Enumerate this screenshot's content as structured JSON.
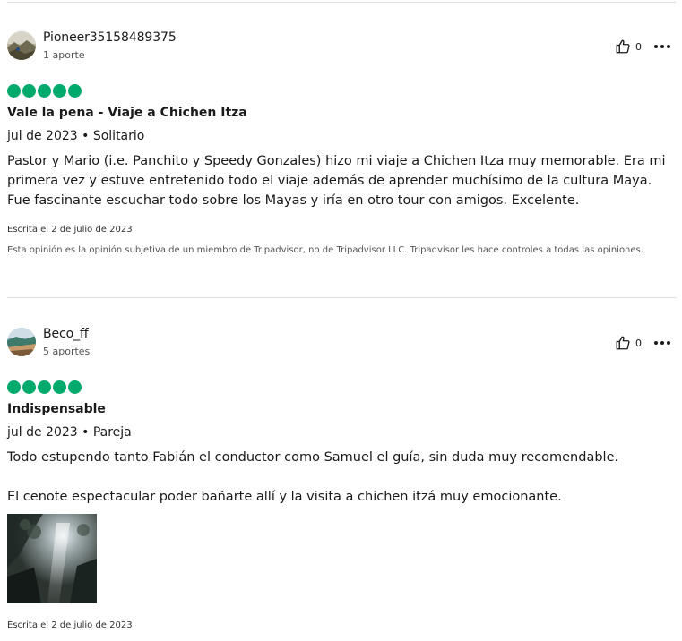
{
  "reviews": [
    {
      "username": "Pioneer35158489375",
      "contributions": "1 aporte",
      "likes": "0",
      "rating": 5,
      "title": "Vale la pena - Viaje a Chichen Itza",
      "meta": "jul de 2023 • Solitario",
      "body": "Pastor y Mario (i.e. Panchito y Speedy Gonzales) hizo mi viaje a Chichen Itza muy memorable. Era mi primera vez y estuve entretenido todo el viaje además de aprender muchísimo de la cultura Maya. Fue fascinante escuchar todo sobre los Mayas y iría en otro tour con amigos. Excelente.",
      "written": "Escrita el 2 de julio de 2023",
      "disclaimer": "Esta opinión es la opinión subjetiva de un miembro de Tripadvisor, no de Tripadvisor LLC. Tripadvisor les hace controles a todas las opiniones."
    },
    {
      "username": "Beco_ff",
      "contributions": "5 aportes",
      "likes": "0",
      "rating": 5,
      "title": "Indispensable",
      "meta": "jul de 2023 • Pareja",
      "body_p1": "Todo estupendo tanto Fabián el conductor como Samuel el guía, sin duda muy recomendable.",
      "body_p2": "El cenote espectacular poder bañarte allí y la visita a chichen itzá muy emocionante.",
      "written": "Escrita el 2 de julio de 2023"
    }
  ],
  "colors": {
    "bubble": "#00aa6c",
    "divider": "#e0e0e0"
  },
  "icons": {
    "like": "thumbs-up-icon",
    "more": "more-options-icon"
  }
}
